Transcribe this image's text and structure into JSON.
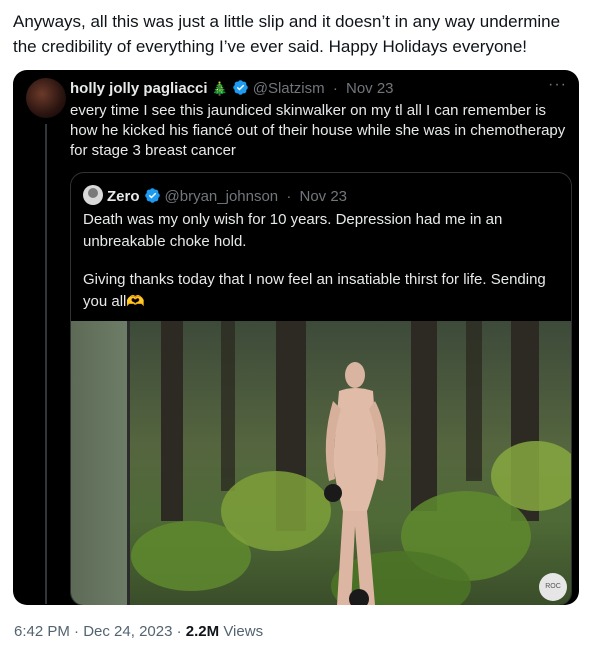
{
  "post": {
    "text": "Anyways, all this was just a little slip and it doesn’t in any way undermine the credibility of everything I’ve ever said. Happy Holidays everyone!",
    "time": "6:42 PM",
    "sep1": "·",
    "date": "Dec 24, 2023",
    "sep2": "·",
    "views_count": "2.2M",
    "views_label": "Views"
  },
  "quoted": {
    "display_name": "holly jolly pagliacci",
    "name_emoji": "🎄",
    "handle": "@Slatzism",
    "sep": "·",
    "date": "Nov 23",
    "more": "···",
    "text": "every time I see this jaundiced skinwalker on my tl all I can remember is how he kicked his fiancé out of their house while she was in chemotherapy for stage 3 breast cancer",
    "verified_color": "#1d9bf0"
  },
  "inner": {
    "display_name": "Zero",
    "handle": "@bryan_johnson",
    "sep": "·",
    "date": "Nov 23",
    "para1": "Death was my only wish for 10 years. Depression had me in an unbreakable choke hold.",
    "para2": "Giving thanks today that I now feel an insatiable thirst for life. Sending you all",
    "para2_emoji": "🫶",
    "badge": "ROC"
  }
}
